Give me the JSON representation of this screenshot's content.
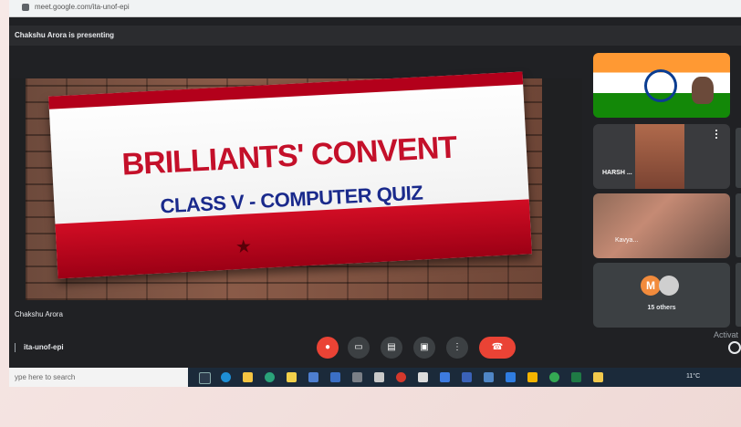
{
  "browser": {
    "url": "meet.google.com/ita-unof-epi"
  },
  "meet": {
    "presenting_banner": "Chakshu Arora is presenting",
    "presenter_name": "Chakshu Arora",
    "meeting_code": "ita-unof-epi",
    "activate_text": "Activat",
    "participants": [
      {
        "label": "",
        "type": "video"
      },
      {
        "label": "HARSH ...",
        "type": "video"
      },
      {
        "label": "Kavya...",
        "type": "video"
      },
      {
        "label": "15 others",
        "type": "others",
        "avatar_letter": "M"
      }
    ]
  },
  "slide": {
    "title": "BRILLIANTS' CONVENT",
    "subtitle": "CLASS V  -  COMPUTER QUIZ"
  },
  "taskbar": {
    "search_placeholder": "ype here to search",
    "weather": "11°C"
  },
  "colors": {
    "meet_bg": "#202124",
    "end_call": "#ea4335",
    "slide_red": "#c4102a",
    "slide_blue": "#1a2a8c"
  }
}
